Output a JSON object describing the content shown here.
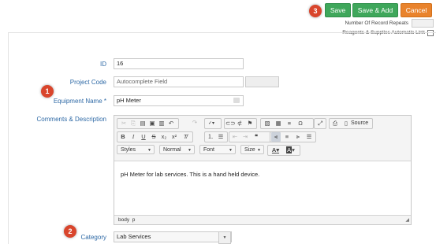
{
  "toolbar": {
    "save_label": "Save",
    "save_add_label": "Save & Add",
    "cancel_label": "Cancel",
    "callout_save": "3"
  },
  "options": {
    "repeats_label": "Number Of Record Repeats",
    "repeats_value": "",
    "reagents_label": "Reagents & Supplies Automatic Link",
    "reagents_checked": false
  },
  "form": {
    "id_label": "ID",
    "id_value": "16",
    "project_code_label": "Project Code",
    "project_code_placeholder": "Autocomplete Field",
    "equipment_name_label": "Equipment Name *",
    "equipment_name_value": "pH Meter",
    "callout_equipment": "1",
    "comments_label": "Comments & Description",
    "category_label": "Category",
    "category_value": "Lab Services",
    "callout_category": "2"
  },
  "editor": {
    "source_label": "Source",
    "styles_label": "Styles",
    "format_label": "Normal",
    "font_label": "Font",
    "size_label": "Size",
    "text_color_label": "A",
    "bg_color_label": "A",
    "content_text": "pH Meter for lab services.  This is a hand held device.",
    "status_path_1": "body",
    "status_path_2": "p"
  }
}
